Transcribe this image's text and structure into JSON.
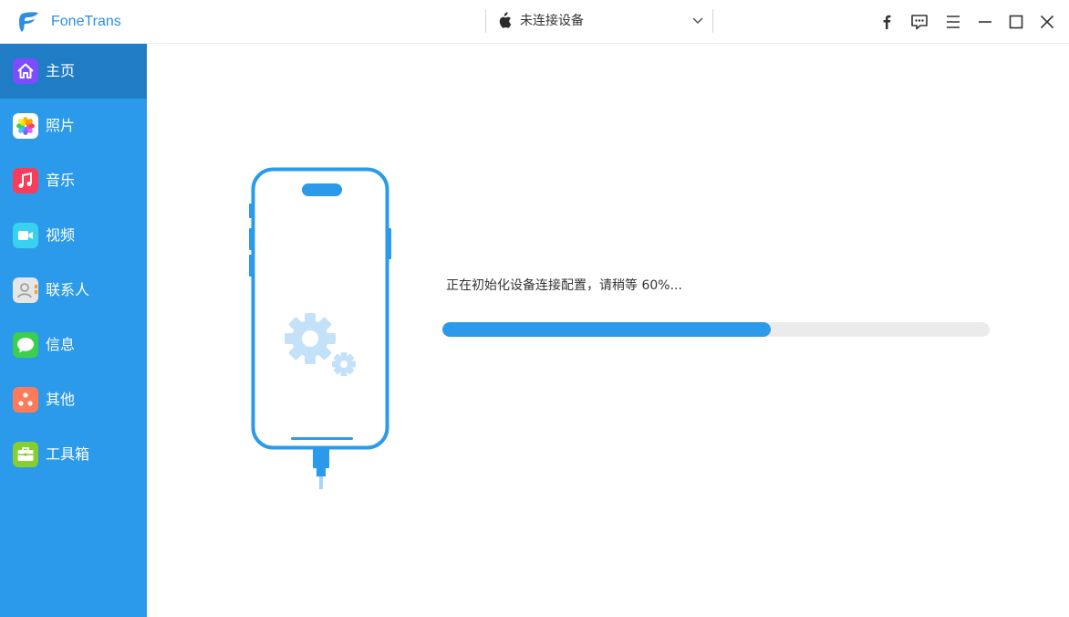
{
  "app": {
    "name": "FoneTrans",
    "accent_color": "#2b9aea",
    "logo_icon": "fonetrans-logo-icon"
  },
  "device_selector": {
    "label": "未连接设备",
    "icon": "apple-icon"
  },
  "window_controls": [
    {
      "name": "facebook-icon"
    },
    {
      "name": "feedback-icon"
    },
    {
      "name": "menu-icon"
    },
    {
      "name": "minimize-icon"
    },
    {
      "name": "maximize-icon"
    },
    {
      "name": "close-icon"
    }
  ],
  "sidebar": {
    "selected": "主页",
    "items": [
      {
        "label": "主页",
        "icon": "home-icon",
        "color": "#7b4dff"
      },
      {
        "label": "照片",
        "icon": "photos-icon",
        "color": "#ffffff"
      },
      {
        "label": "音乐",
        "icon": "music-icon",
        "color": "#fa3c5a"
      },
      {
        "label": "视频",
        "icon": "video-icon",
        "color": "#38d1f0"
      },
      {
        "label": "联系人",
        "icon": "contacts-icon",
        "color": "#e6e6e6"
      },
      {
        "label": "信息",
        "icon": "messages-icon",
        "color": "#3ccf4e"
      },
      {
        "label": "其他",
        "icon": "others-icon",
        "color": "#ff7a59"
      },
      {
        "label": "工具箱",
        "icon": "toolbox-icon",
        "color": "#86cf2e"
      }
    ]
  },
  "main": {
    "illustration": "phone-settings-icon",
    "status_text": "正在初始化设备连接配置，请稍等 60%...",
    "progress": 0.6
  }
}
